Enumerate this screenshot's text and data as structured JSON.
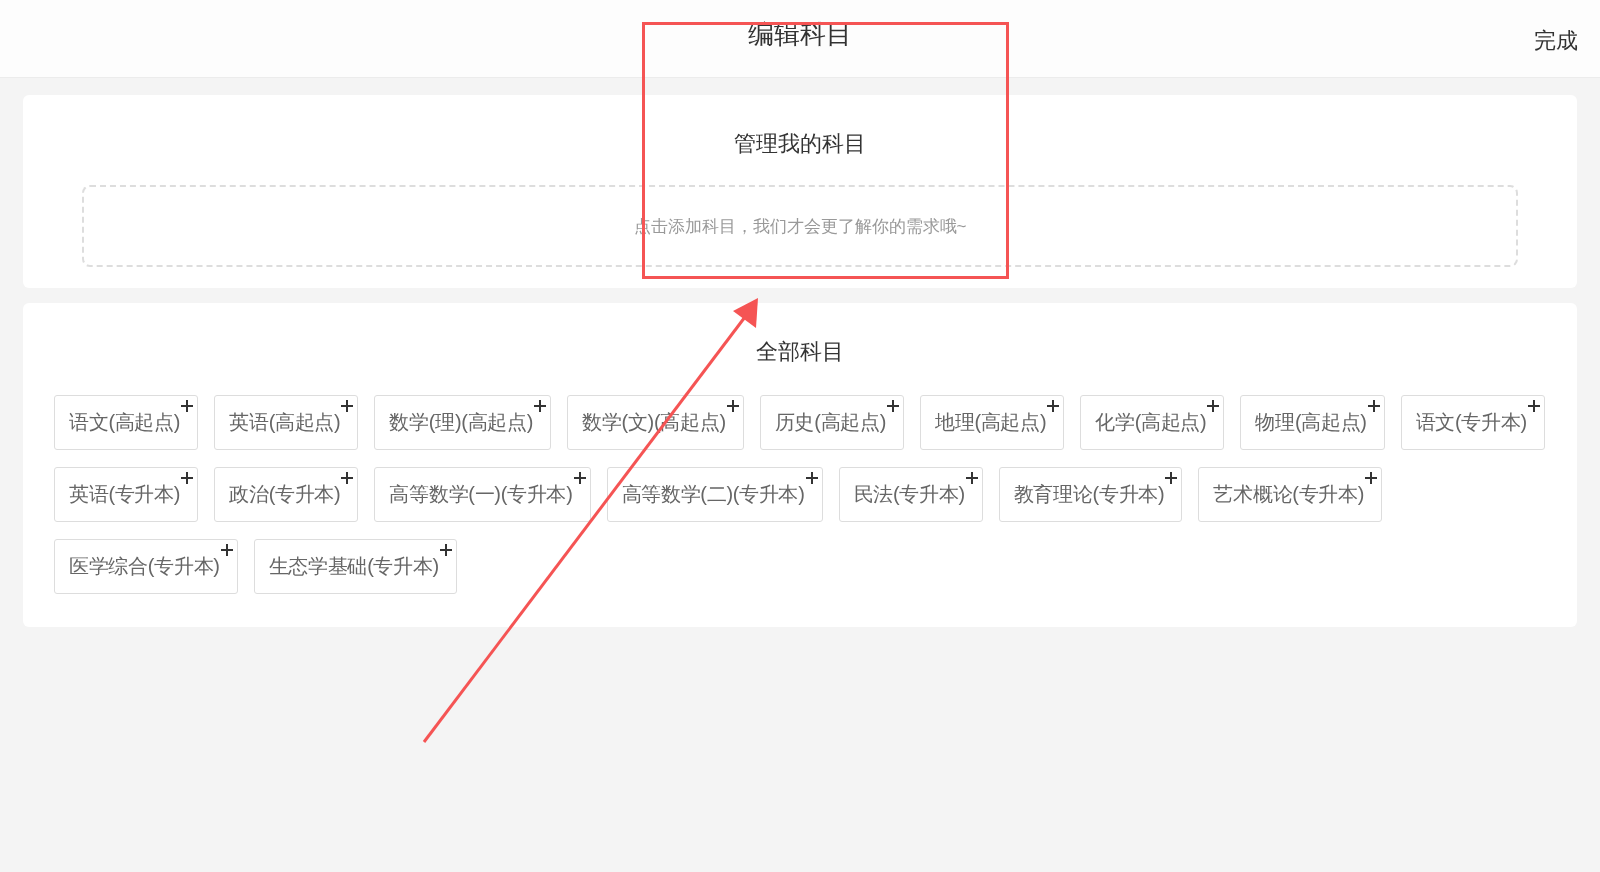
{
  "header": {
    "title": "编辑科目",
    "done_button": "完成"
  },
  "my_subjects": {
    "title": "管理我的科目",
    "placeholder": "点击添加科目，我们才会更了解你的需求哦~"
  },
  "all_subjects": {
    "title": "全部科目",
    "items": [
      {
        "label": "语文(高起点)"
      },
      {
        "label": "英语(高起点)"
      },
      {
        "label": "数学(理)(高起点)"
      },
      {
        "label": "数学(文)(高起点)"
      },
      {
        "label": "历史(高起点)"
      },
      {
        "label": "地理(高起点)"
      },
      {
        "label": "化学(高起点)"
      },
      {
        "label": "物理(高起点)"
      },
      {
        "label": "语文(专升本)"
      },
      {
        "label": "英语(专升本)"
      },
      {
        "label": "政治(专升本)"
      },
      {
        "label": "高等数学(一)(专升本)"
      },
      {
        "label": "高等数学(二)(专升本)"
      },
      {
        "label": "民法(专升本)"
      },
      {
        "label": "教育理论(专升本)"
      },
      {
        "label": "艺术概论(专升本)"
      },
      {
        "label": "医学综合(专升本)"
      },
      {
        "label": "生态学基础(专升本)"
      }
    ]
  }
}
